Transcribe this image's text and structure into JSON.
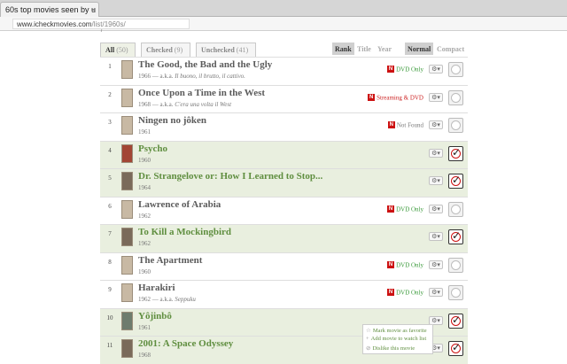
{
  "browser": {
    "tab_title": "60s top movies seen by u",
    "tab_close": "×",
    "url_host": "www.icheckmovies.com",
    "url_path": "/list/1960s/",
    "url_cursor": "/"
  },
  "filters": {
    "all_label": "All",
    "all_count": "(50)",
    "checked_label": "Checked",
    "checked_count": "(9)",
    "unchecked_label": "Unchecked",
    "unchecked_count": "(41)",
    "sort_rank": "Rank",
    "sort_title": "Title",
    "sort_year": "Year",
    "view_normal": "Normal",
    "view_compact": "Compact"
  },
  "movies": [
    {
      "rank": "1",
      "title": "The Good, the Bad and the Ugly",
      "year_line": "1966 — a.k.a.",
      "aka": "Il buono, il brutto, il cattivo.",
      "availability": "DVD Only",
      "avail_style": "green",
      "checked": false,
      "poster": "l"
    },
    {
      "rank": "2",
      "title": "Once Upon a Time in the West",
      "year_line": "1968 — a.k.a.",
      "aka": "C'era una volta il West",
      "availability": "Streaming & DVD",
      "avail_style": "red",
      "checked": false,
      "poster": "l"
    },
    {
      "rank": "3",
      "title": "Ningen no jôken",
      "year_line": "1961",
      "aka": "",
      "availability": "Not Found",
      "avail_style": "grey",
      "checked": false,
      "poster": "l"
    },
    {
      "rank": "4",
      "title": "Psycho",
      "year_line": "1960",
      "aka": "",
      "availability": "",
      "avail_style": "",
      "checked": true,
      "poster": "r"
    },
    {
      "rank": "5",
      "title": "Dr. Strangelove or: How I Learned to Stop...",
      "year_line": "1964",
      "aka": "",
      "availability": "",
      "avail_style": "",
      "checked": true,
      "poster": "d"
    },
    {
      "rank": "6",
      "title": "Lawrence of Arabia",
      "year_line": "1962",
      "aka": "",
      "availability": "DVD Only",
      "avail_style": "green",
      "checked": false,
      "poster": "l"
    },
    {
      "rank": "7",
      "title": "To Kill a Mockingbird",
      "year_line": "1962",
      "aka": "",
      "availability": "",
      "avail_style": "",
      "checked": true,
      "poster": "d"
    },
    {
      "rank": "8",
      "title": "The Apartment",
      "year_line": "1960",
      "aka": "",
      "availability": "DVD Only",
      "avail_style": "green",
      "checked": false,
      "poster": "l"
    },
    {
      "rank": "9",
      "title": "Harakiri",
      "year_line": "1962 — a.k.a.",
      "aka": "Seppuku",
      "availability": "DVD Only",
      "avail_style": "green",
      "checked": false,
      "poster": "l"
    },
    {
      "rank": "10",
      "title": "Yôjinbô",
      "year_line": "1961",
      "aka": "",
      "availability": "",
      "avail_style": "",
      "checked": true,
      "poster": "g"
    },
    {
      "rank": "11",
      "title": "2001: A Space Odyssey",
      "year_line": "1968",
      "aka": "",
      "availability": "",
      "avail_style": "",
      "checked": true,
      "poster": "d"
    }
  ],
  "row_menu": {
    "favorite": "Mark movie as favorite",
    "watchlist": "Add movie to watch list",
    "dislike": "Dislike this movie"
  },
  "icons": {
    "availability_badge": "N",
    "gear": "⚙▾",
    "tick": "✓",
    "menu_star": "☆",
    "menu_plus": "+",
    "menu_x": "⊘"
  }
}
